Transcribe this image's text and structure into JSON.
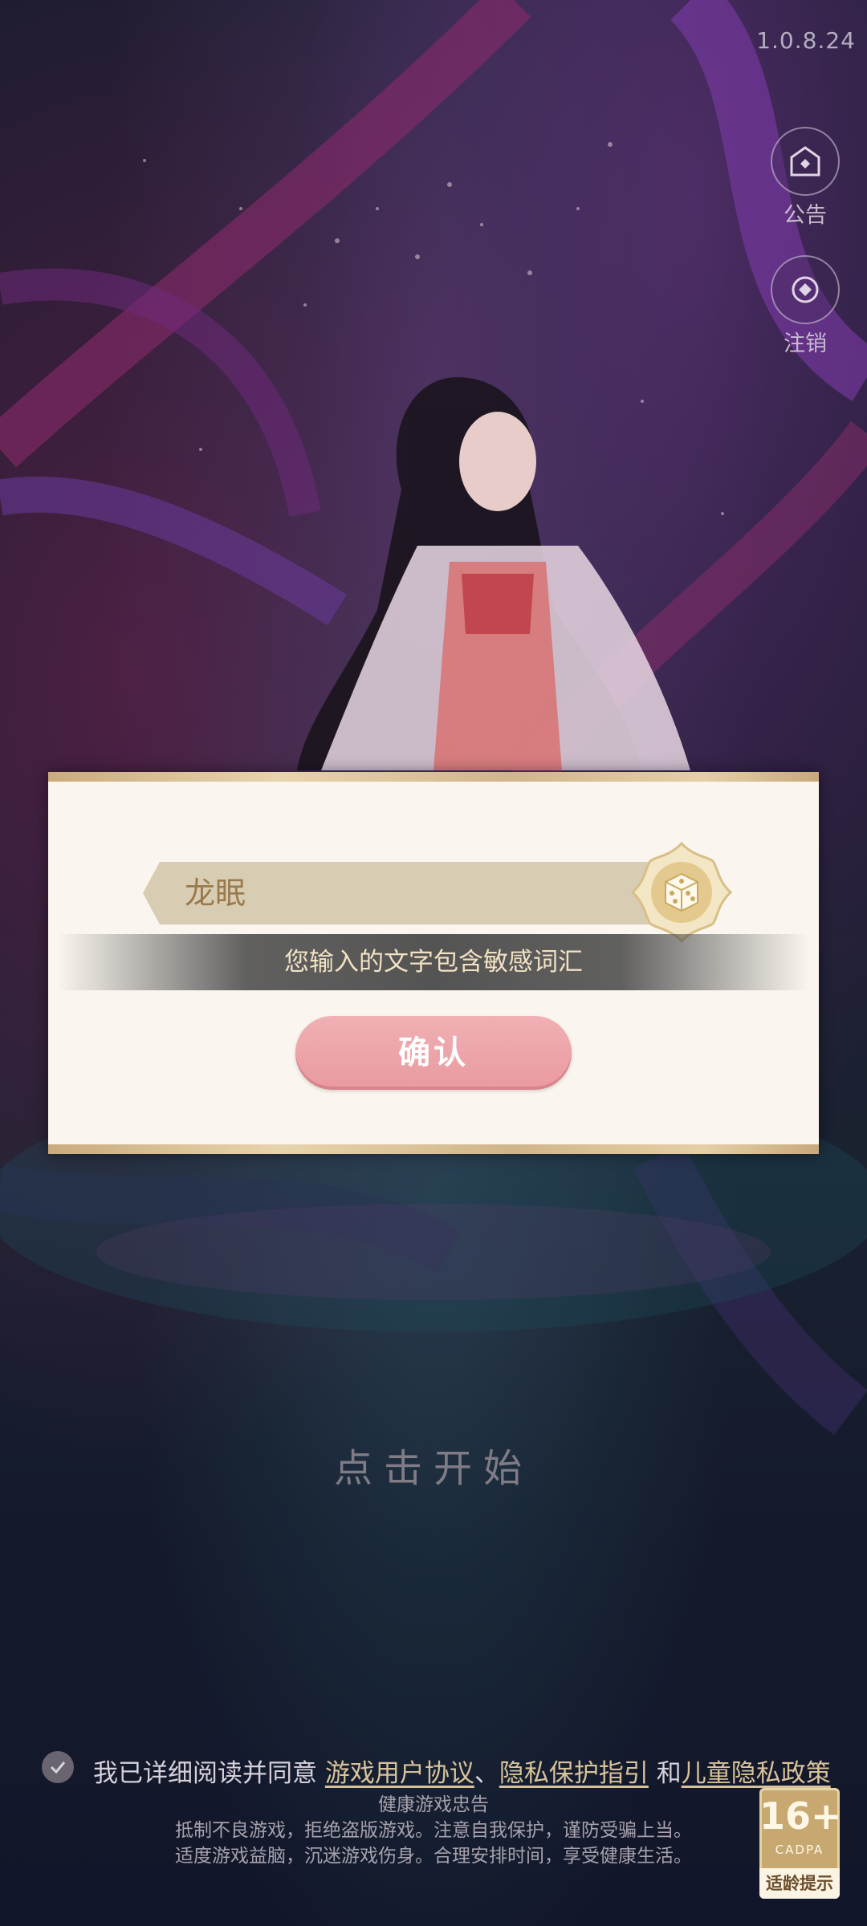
{
  "version": "1.0.8.24",
  "side_buttons": {
    "notice_label": "公告",
    "logout_label": "注销"
  },
  "dialog": {
    "name_value": "龙眠",
    "warning_text": "您输入的文字包含敏感词汇",
    "confirm_label": "确认"
  },
  "tap_to_start": "点击开始",
  "agreement": {
    "prefix": "我已详细阅读并同意",
    "link_user_agreement": "游戏用户协议",
    "sep": "、",
    "link_privacy": "隐私保护指引",
    "and": "和",
    "link_child_privacy": "儿童隐私政策",
    "checked": true
  },
  "health_notice": {
    "title": "健康游戏忠告",
    "line1": "抵制不良游戏，拒绝盗版游戏。注意自我保护，谨防受骗上当。",
    "line2": "适度游戏益脑，沉迷游戏伤身。合理安排时间，享受健康生活。"
  },
  "age_rating": {
    "age": "16+",
    "org": "CADPA",
    "tip": "适龄提示"
  },
  "colors": {
    "dialog_bg": "#faf5ee",
    "confirm_pink": "#e99aa0",
    "gold": "#c8a871"
  }
}
